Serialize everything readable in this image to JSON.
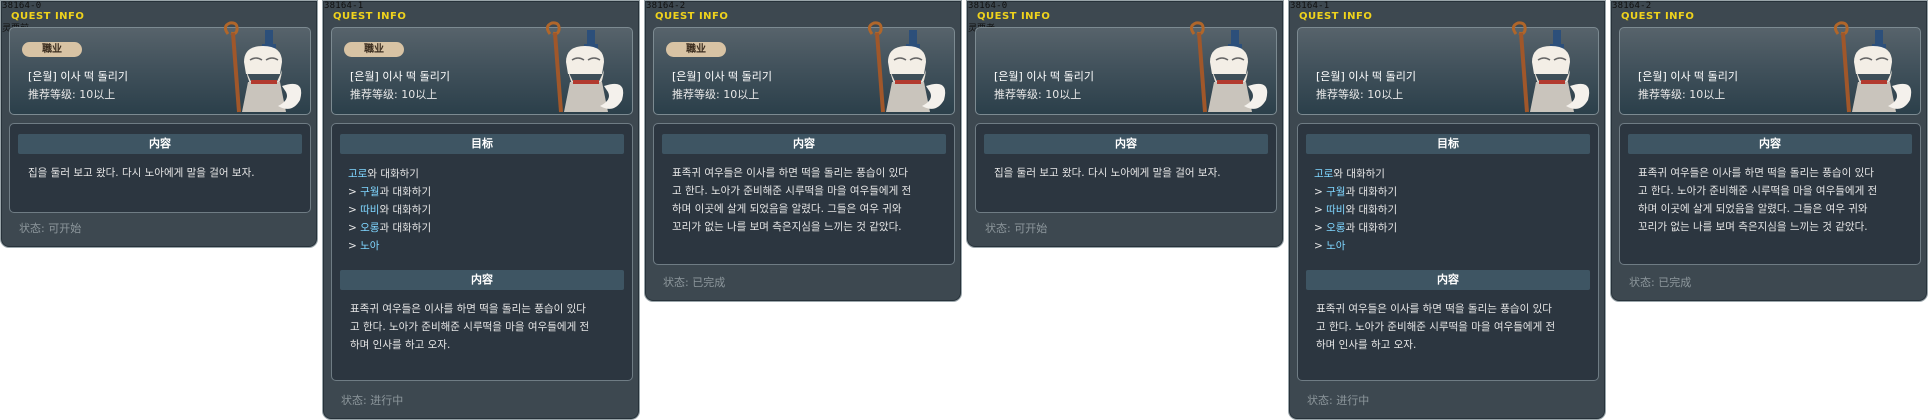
{
  "header_label": "QUEST INFO",
  "job_label": "職业",
  "quest_title": "[은월] 이사 떡 돌리기",
  "level_text": "推荐等级:  10以上",
  "section_goal": "目标",
  "section_content": "内容",
  "panels": [
    {
      "id": "38164-0",
      "sublabel": "灵要前",
      "content": [
        "집을 둘러 보고 왔다. 다시 노아에게 말을 걸어 보자."
      ],
      "status": "状态:  可开始"
    },
    {
      "id": "38164-1",
      "objectives": [
        {
          "pre": "",
          "name": "고로",
          "post": "와 대화하기"
        },
        {
          "pre": "> ",
          "name": "구월",
          "post": "과 대화하기"
        },
        {
          "pre": "> ",
          "name": "따비",
          "post": "와 대화하기"
        },
        {
          "pre": "> ",
          "name": "오롱",
          "post": "과 대화하기"
        },
        {
          "pre": "> ",
          "name": "노아",
          "post": ""
        }
      ],
      "content": [
        "표족귀 여우들은 이사를 하면 떡을 돌리는 풍습이 있다",
        "고 한다. 노아가 준비해준 시루떡을 마을 여우들에게 전",
        "하며 인사를 하고 오자."
      ],
      "status": "状态:  进行中"
    },
    {
      "id": "38164-2",
      "content": [
        "표족귀 여우들은 이사를 하면 떡을 돌리는 풍습이 있다",
        "고 한다. 노아가 준비해준 시루떡을 마을 여우들에게 전",
        "하며 이곳에 살게 되었음을 알렸다. 그들은 여우 귀와",
        "꼬리가 없는 나를 보며 측은지심을 느끼는 것 같았다."
      ],
      "status": "状态:  已完成"
    },
    {
      "id": "38164-0",
      "sublabel": "灵要者",
      "content": [
        "집을 둘러 보고 왔다. 다시 노아에게 말을 걸어 보자."
      ],
      "status": "状态:  可开始"
    },
    {
      "id": "38164-1",
      "objectives": [
        {
          "pre": "",
          "name": "고로",
          "post": "와 대화하기"
        },
        {
          "pre": "> ",
          "name": "구월",
          "post": "과 대화하기"
        },
        {
          "pre": "> ",
          "name": "따비",
          "post": "와 대화하기"
        },
        {
          "pre": "> ",
          "name": "오롱",
          "post": "과 대화하기"
        },
        {
          "pre": "> ",
          "name": "노아",
          "post": ""
        }
      ],
      "content": [
        "표족귀 여우들은 이사를 하면 떡을 돌리는 풍습이 있다",
        "고 한다. 노아가 준비해준 시루떡을 마을 여우들에게 전",
        "하며 인사를 하고 오자."
      ],
      "status": "状态:  进行中"
    },
    {
      "id": "38164-2",
      "content": [
        "표족귀 여우들은 이사를 하면 떡을 돌리는 풍습이 있다",
        "고 한다. 노아가 준비해준 시루떡을 마을 여우들에게 전",
        "하며 이곳에 살게 되었음을 알렸다. 그들은 여우 귀와",
        "꼬리가 없는 나를 보며 측은지심을 느끼는 것 같았다."
      ],
      "status": "状态:  已完成"
    }
  ]
}
